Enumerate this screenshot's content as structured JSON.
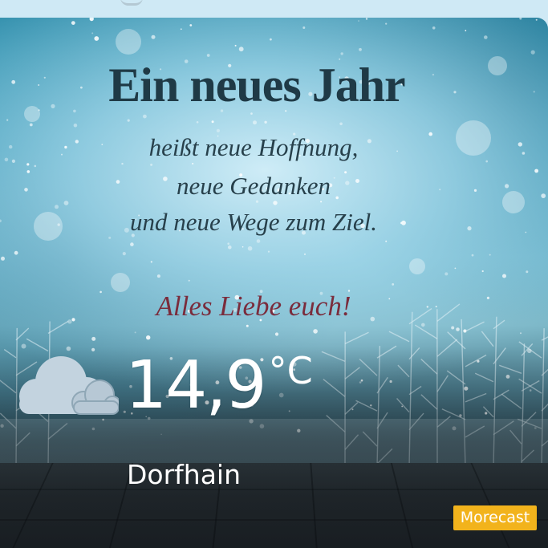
{
  "greeting": {
    "headline": "Ein neues Jahr",
    "lines": [
      "heißt neue Hoffnung,",
      "neue Gedanken",
      "und neue Wege zum Ziel."
    ],
    "closing": "Alles Liebe euch!"
  },
  "weather": {
    "icon": "cloud-icon",
    "temperature": "14,9",
    "unit": "°C",
    "location": "Dorfhain"
  },
  "brand": {
    "label": "Morecast",
    "color": "#f2b31c"
  },
  "colors": {
    "headline": "#1f3a46",
    "closing": "#7a2c3c"
  }
}
